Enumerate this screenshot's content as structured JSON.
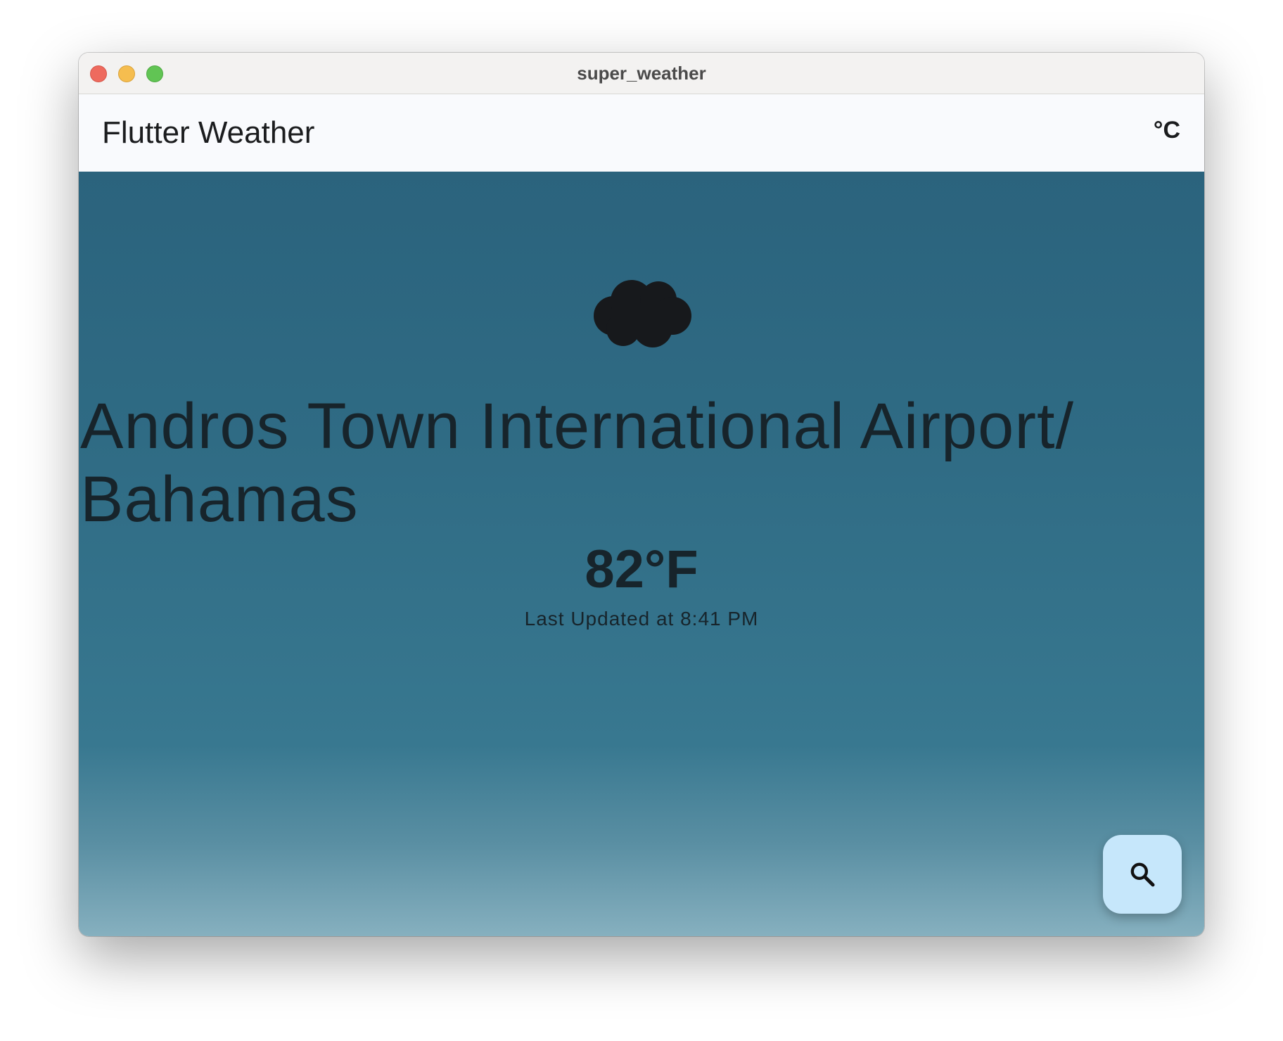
{
  "window": {
    "title": "super_weather"
  },
  "appbar": {
    "title": "Flutter Weather",
    "unit_toggle_label": "°C"
  },
  "weather": {
    "condition_icon": "cloud-icon",
    "location": "Andros Town International Airport/ Bahamas",
    "temperature": "82°F",
    "last_updated": "Last Updated at 8:41 PM"
  },
  "fab": {
    "icon": "search-icon"
  },
  "colors": {
    "background_top": "#2b637d",
    "background_bottom": "#86b0bf",
    "fab_background": "#c6e7fb",
    "text_dark": "#17242b"
  }
}
